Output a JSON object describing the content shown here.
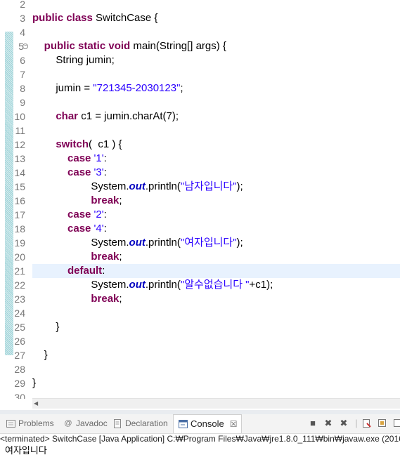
{
  "editor": {
    "line_numbers": [
      "2",
      "3",
      "4",
      "5",
      "6",
      "7",
      "8",
      "9",
      "10",
      "11",
      "12",
      "13",
      "14",
      "15",
      "16",
      "17",
      "18",
      "19",
      "20",
      "21",
      "22",
      "23",
      "24",
      "25",
      "26",
      "27",
      "28",
      "29",
      "30"
    ],
    "lines": [
      [],
      [
        {
          "t": "public class ",
          "c": "kw"
        },
        {
          "t": "SwitchCase {",
          "c": ""
        }
      ],
      [],
      [
        {
          "t": "    public static void ",
          "c": "kw"
        },
        {
          "t": "main(String[] ",
          "c": ""
        },
        {
          "t": "args",
          "c": "var"
        },
        {
          "t": ") {",
          "c": ""
        }
      ],
      [
        {
          "t": "        String ",
          "c": ""
        },
        {
          "t": "jumin",
          "c": "var"
        },
        {
          "t": ";",
          "c": ""
        }
      ],
      [],
      [
        {
          "t": "        jumin",
          "c": "var"
        },
        {
          "t": " = ",
          "c": ""
        },
        {
          "t": "\"721345-2030123\"",
          "c": "str"
        },
        {
          "t": ";",
          "c": ""
        }
      ],
      [],
      [
        {
          "t": "        char ",
          "c": "kw"
        },
        {
          "t": "c1",
          "c": "var"
        },
        {
          "t": " = ",
          "c": ""
        },
        {
          "t": "jumin",
          "c": "var"
        },
        {
          "t": ".charAt(7);",
          "c": ""
        }
      ],
      [],
      [
        {
          "t": "        switch",
          "c": "kw"
        },
        {
          "t": "(  ",
          "c": ""
        },
        {
          "t": "c1",
          "c": "var"
        },
        {
          "t": " ) {",
          "c": ""
        }
      ],
      [
        {
          "t": "            case ",
          "c": "kw"
        },
        {
          "t": "'1'",
          "c": "str"
        },
        {
          "t": ":",
          "c": ""
        }
      ],
      [
        {
          "t": "            case ",
          "c": "kw"
        },
        {
          "t": "'3'",
          "c": "str"
        },
        {
          "t": ":",
          "c": ""
        }
      ],
      [
        {
          "t": "                    System.",
          "c": ""
        },
        {
          "t": "out",
          "c": "fld"
        },
        {
          "t": ".println(",
          "c": ""
        },
        {
          "t": "\"남자입니다\"",
          "c": "str"
        },
        {
          "t": ");",
          "c": ""
        }
      ],
      [
        {
          "t": "                    break",
          "c": "kw"
        },
        {
          "t": ";",
          "c": ""
        }
      ],
      [
        {
          "t": "            case ",
          "c": "kw"
        },
        {
          "t": "'2'",
          "c": "str"
        },
        {
          "t": ":",
          "c": ""
        }
      ],
      [
        {
          "t": "            case ",
          "c": "kw"
        },
        {
          "t": "'4'",
          "c": "str"
        },
        {
          "t": ":",
          "c": ""
        }
      ],
      [
        {
          "t": "                    System.",
          "c": ""
        },
        {
          "t": "out",
          "c": "fld"
        },
        {
          "t": ".println(",
          "c": ""
        },
        {
          "t": "\"여자입니다\"",
          "c": "str"
        },
        {
          "t": ");",
          "c": ""
        }
      ],
      [
        {
          "t": "                    break",
          "c": "kw"
        },
        {
          "t": ";",
          "c": ""
        }
      ],
      [
        {
          "t": "            default",
          "c": "kw"
        },
        {
          "t": ":",
          "c": ""
        }
      ],
      [
        {
          "t": "                    System.",
          "c": ""
        },
        {
          "t": "out",
          "c": "fld"
        },
        {
          "t": ".println(",
          "c": ""
        },
        {
          "t": "\"알수없습니다 \"",
          "c": "str"
        },
        {
          "t": "+",
          "c": ""
        },
        {
          "t": "c1",
          "c": "var"
        },
        {
          "t": ");",
          "c": ""
        }
      ],
      [
        {
          "t": "                    break",
          "c": "kw"
        },
        {
          "t": ";",
          "c": ""
        }
      ],
      [],
      [
        {
          "t": "        }",
          "c": ""
        }
      ],
      [],
      [
        {
          "t": "    }",
          "c": ""
        }
      ],
      [],
      [
        {
          "t": "}",
          "c": ""
        }
      ],
      []
    ],
    "highlighted_line": "21"
  },
  "views": {
    "tabs": [
      {
        "label": "Problems",
        "icon": "problems-icon",
        "active": false
      },
      {
        "label": "Javadoc",
        "icon": "at-icon",
        "active": false
      },
      {
        "label": "Declaration",
        "icon": "declaration-icon",
        "active": false
      },
      {
        "label": "Console",
        "icon": "console-icon",
        "active": true
      }
    ],
    "close_glyph": "☒"
  },
  "console": {
    "header": "<terminated> SwitchCase [Java Application] C:₩Program Files₩Java₩jre1.8.0_111₩bin₩javaw.exe (2016",
    "output": "여자입니다"
  },
  "colors": {
    "keyword": "#7f0055",
    "string": "#2a00ff",
    "field": "#0000c0",
    "current_line": "#e8f2fe"
  }
}
